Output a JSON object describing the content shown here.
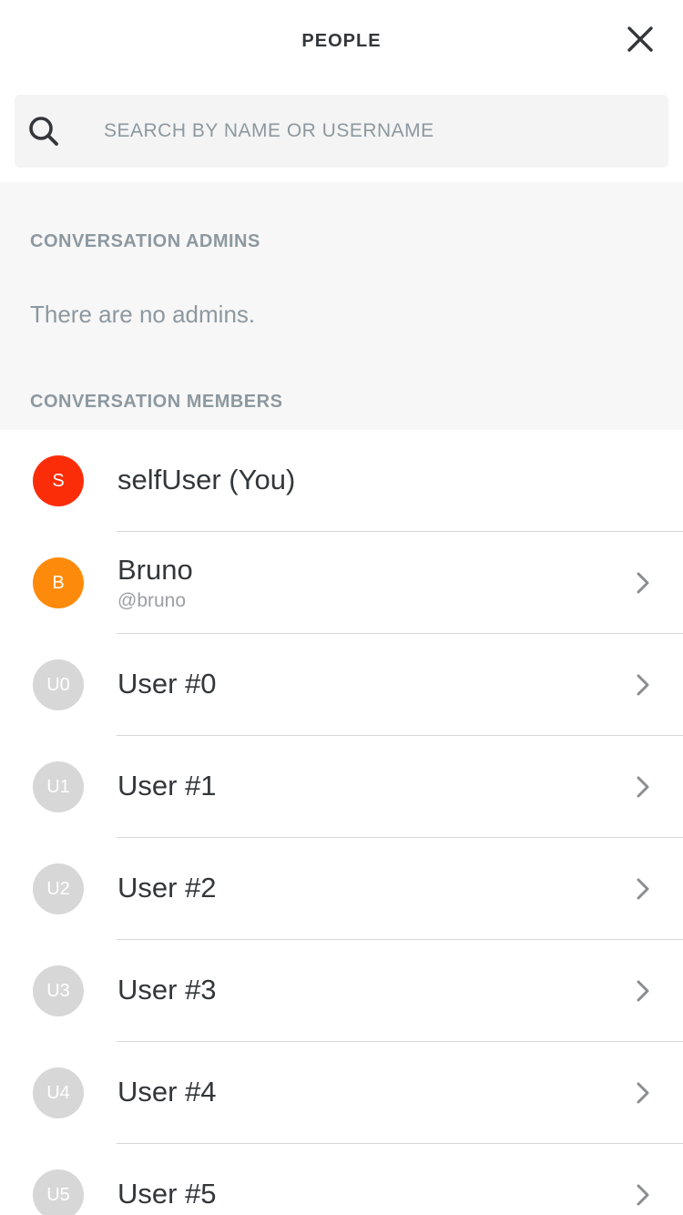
{
  "header": {
    "title": "PEOPLE",
    "close_icon": "close-icon"
  },
  "search": {
    "placeholder": "SEARCH BY NAME OR USERNAME",
    "value": "",
    "icon": "search-icon"
  },
  "admins": {
    "heading": "CONVERSATION ADMINS",
    "empty_text": "There are no admins."
  },
  "members": {
    "heading": "CONVERSATION MEMBERS",
    "items": [
      {
        "initials": "S",
        "name": "selfUser (You)",
        "handle": "",
        "color": "#fb2d09",
        "has_chevron": false
      },
      {
        "initials": "B",
        "name": "Bruno",
        "handle": "@bruno",
        "color": "#fe8a0c",
        "has_chevron": true
      },
      {
        "initials": "U0",
        "name": "User #0",
        "handle": "",
        "color": "#d7d7d7",
        "has_chevron": true
      },
      {
        "initials": "U1",
        "name": "User #1",
        "handle": "",
        "color": "#d7d7d7",
        "has_chevron": true
      },
      {
        "initials": "U2",
        "name": "User #2",
        "handle": "",
        "color": "#d7d7d7",
        "has_chevron": true
      },
      {
        "initials": "U3",
        "name": "User #3",
        "handle": "",
        "color": "#d7d7d7",
        "has_chevron": true
      },
      {
        "initials": "U4",
        "name": "User #4",
        "handle": "",
        "color": "#d7d7d7",
        "has_chevron": true
      },
      {
        "initials": "U5",
        "name": "User #5",
        "handle": "",
        "color": "#d7d7d7",
        "has_chevron": true
      }
    ]
  },
  "colors": {
    "text_primary": "#33373a",
    "text_secondary": "#8d989f",
    "section_background": "#f7f7f7",
    "search_background": "#f4f4f4"
  }
}
